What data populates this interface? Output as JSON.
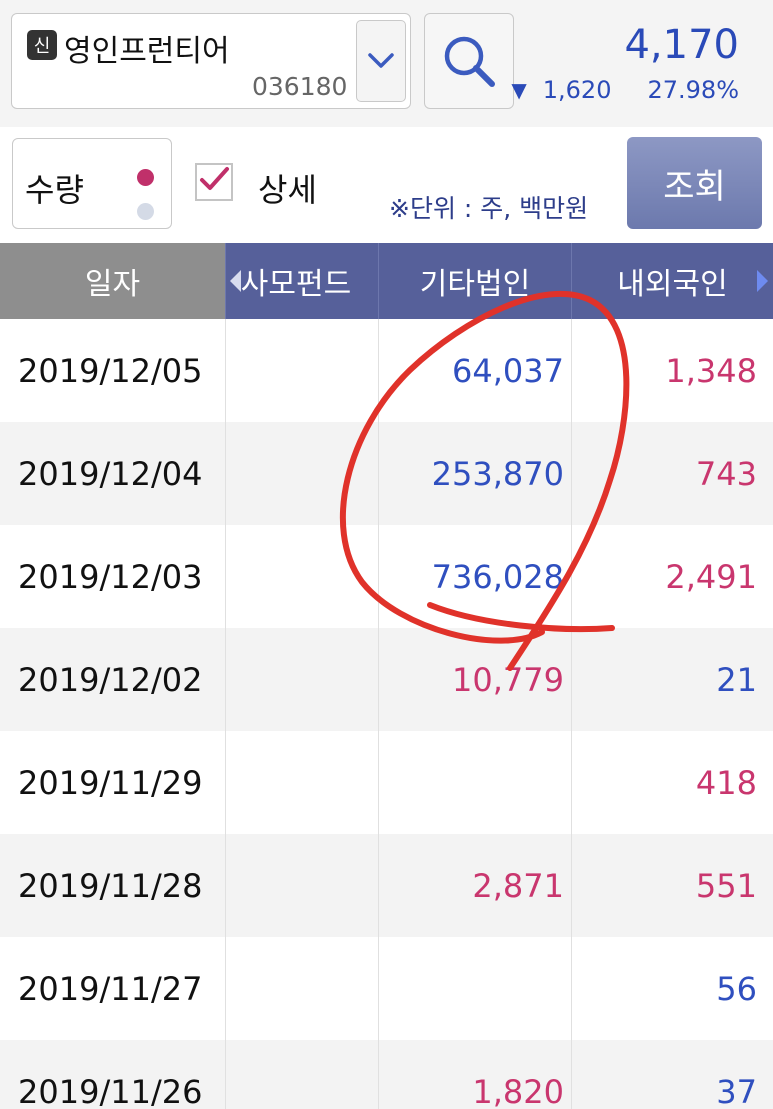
{
  "header": {
    "badge": "신",
    "stock_name": "영인프런티어",
    "stock_code": "036180",
    "price": "4,170",
    "change_symbol": "▼",
    "change_value": "1,620",
    "change_pct": "27.98%"
  },
  "options": {
    "qty_label": "수량",
    "detail_label": "상세",
    "detail_checked": true,
    "unit_label": "※단위 : 주, 백만원",
    "query_label": "조회"
  },
  "table": {
    "headers": {
      "date": "일자",
      "col1": "사모펀드",
      "col2": "기타법인",
      "col3": "내외국인"
    },
    "rows": [
      {
        "date": "2019/12/05",
        "c2": "64,037",
        "c2_color": "blue",
        "c3": "1,348",
        "c3_color": "red"
      },
      {
        "date": "2019/12/04",
        "c2": "253,870",
        "c2_color": "blue",
        "c3": "743",
        "c3_color": "red"
      },
      {
        "date": "2019/12/03",
        "c2": "736,028",
        "c2_color": "blue",
        "c3": "2,491",
        "c3_color": "red"
      },
      {
        "date": "2019/12/02",
        "c2": "10,779",
        "c2_color": "red",
        "c3": "21",
        "c3_color": "blue"
      },
      {
        "date": "2019/11/29",
        "c2": "",
        "c2_color": "red",
        "c3": "418",
        "c3_color": "red"
      },
      {
        "date": "2019/11/28",
        "c2": "2,871",
        "c2_color": "red",
        "c3": "551",
        "c3_color": "red"
      },
      {
        "date": "2019/11/27",
        "c2": "",
        "c2_color": "red",
        "c3": "56",
        "c3_color": "blue"
      },
      {
        "date": "2019/11/26",
        "c2": "1,820",
        "c2_color": "red",
        "c3": "37",
        "c3_color": "blue"
      }
    ]
  },
  "colors": {
    "accent_blue": "#2f4fbf",
    "accent_red": "#c9366e",
    "header_bar": "#56609a",
    "annotation": "#e0322a"
  },
  "icons": [
    "search-icon",
    "chevron-down-icon",
    "check-icon",
    "arrow-left-icon",
    "arrow-right-icon"
  ]
}
